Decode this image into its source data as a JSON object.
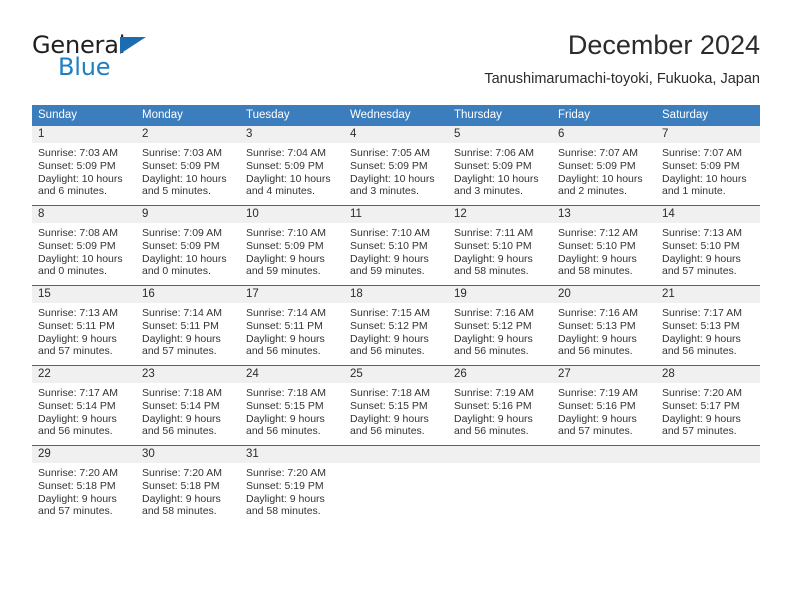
{
  "logo": {
    "line1": "General",
    "line2": "Blue",
    "triangle_color": "#1b6cb0",
    "blue_color": "#1e7fc4"
  },
  "header": {
    "title": "December 2024",
    "subtitle": "Tanushimarumachi-toyoki, Fukuoka, Japan"
  },
  "theme": {
    "header_blue": "#3B7DBD",
    "rule_blue": "#2E6DA4",
    "day_band": "#F0F0F0"
  },
  "weekdays": [
    "Sunday",
    "Monday",
    "Tuesday",
    "Wednesday",
    "Thursday",
    "Friday",
    "Saturday"
  ],
  "weeks": [
    [
      {
        "day": "1",
        "sunrise": "Sunrise: 7:03 AM",
        "sunset": "Sunset: 5:09 PM",
        "daylight_line1": "Daylight: 10 hours",
        "daylight_line2": "and 6 minutes."
      },
      {
        "day": "2",
        "sunrise": "Sunrise: 7:03 AM",
        "sunset": "Sunset: 5:09 PM",
        "daylight_line1": "Daylight: 10 hours",
        "daylight_line2": "and 5 minutes."
      },
      {
        "day": "3",
        "sunrise": "Sunrise: 7:04 AM",
        "sunset": "Sunset: 5:09 PM",
        "daylight_line1": "Daylight: 10 hours",
        "daylight_line2": "and 4 minutes."
      },
      {
        "day": "4",
        "sunrise": "Sunrise: 7:05 AM",
        "sunset": "Sunset: 5:09 PM",
        "daylight_line1": "Daylight: 10 hours",
        "daylight_line2": "and 3 minutes."
      },
      {
        "day": "5",
        "sunrise": "Sunrise: 7:06 AM",
        "sunset": "Sunset: 5:09 PM",
        "daylight_line1": "Daylight: 10 hours",
        "daylight_line2": "and 3 minutes."
      },
      {
        "day": "6",
        "sunrise": "Sunrise: 7:07 AM",
        "sunset": "Sunset: 5:09 PM",
        "daylight_line1": "Daylight: 10 hours",
        "daylight_line2": "and 2 minutes."
      },
      {
        "day": "7",
        "sunrise": "Sunrise: 7:07 AM",
        "sunset": "Sunset: 5:09 PM",
        "daylight_line1": "Daylight: 10 hours",
        "daylight_line2": "and 1 minute."
      }
    ],
    [
      {
        "day": "8",
        "sunrise": "Sunrise: 7:08 AM",
        "sunset": "Sunset: 5:09 PM",
        "daylight_line1": "Daylight: 10 hours",
        "daylight_line2": "and 0 minutes."
      },
      {
        "day": "9",
        "sunrise": "Sunrise: 7:09 AM",
        "sunset": "Sunset: 5:09 PM",
        "daylight_line1": "Daylight: 10 hours",
        "daylight_line2": "and 0 minutes."
      },
      {
        "day": "10",
        "sunrise": "Sunrise: 7:10 AM",
        "sunset": "Sunset: 5:09 PM",
        "daylight_line1": "Daylight: 9 hours",
        "daylight_line2": "and 59 minutes."
      },
      {
        "day": "11",
        "sunrise": "Sunrise: 7:10 AM",
        "sunset": "Sunset: 5:10 PM",
        "daylight_line1": "Daylight: 9 hours",
        "daylight_line2": "and 59 minutes."
      },
      {
        "day": "12",
        "sunrise": "Sunrise: 7:11 AM",
        "sunset": "Sunset: 5:10 PM",
        "daylight_line1": "Daylight: 9 hours",
        "daylight_line2": "and 58 minutes."
      },
      {
        "day": "13",
        "sunrise": "Sunrise: 7:12 AM",
        "sunset": "Sunset: 5:10 PM",
        "daylight_line1": "Daylight: 9 hours",
        "daylight_line2": "and 58 minutes."
      },
      {
        "day": "14",
        "sunrise": "Sunrise: 7:13 AM",
        "sunset": "Sunset: 5:10 PM",
        "daylight_line1": "Daylight: 9 hours",
        "daylight_line2": "and 57 minutes."
      }
    ],
    [
      {
        "day": "15",
        "sunrise": "Sunrise: 7:13 AM",
        "sunset": "Sunset: 5:11 PM",
        "daylight_line1": "Daylight: 9 hours",
        "daylight_line2": "and 57 minutes."
      },
      {
        "day": "16",
        "sunrise": "Sunrise: 7:14 AM",
        "sunset": "Sunset: 5:11 PM",
        "daylight_line1": "Daylight: 9 hours",
        "daylight_line2": "and 57 minutes."
      },
      {
        "day": "17",
        "sunrise": "Sunrise: 7:14 AM",
        "sunset": "Sunset: 5:11 PM",
        "daylight_line1": "Daylight: 9 hours",
        "daylight_line2": "and 56 minutes."
      },
      {
        "day": "18",
        "sunrise": "Sunrise: 7:15 AM",
        "sunset": "Sunset: 5:12 PM",
        "daylight_line1": "Daylight: 9 hours",
        "daylight_line2": "and 56 minutes."
      },
      {
        "day": "19",
        "sunrise": "Sunrise: 7:16 AM",
        "sunset": "Sunset: 5:12 PM",
        "daylight_line1": "Daylight: 9 hours",
        "daylight_line2": "and 56 minutes."
      },
      {
        "day": "20",
        "sunrise": "Sunrise: 7:16 AM",
        "sunset": "Sunset: 5:13 PM",
        "daylight_line1": "Daylight: 9 hours",
        "daylight_line2": "and 56 minutes."
      },
      {
        "day": "21",
        "sunrise": "Sunrise: 7:17 AM",
        "sunset": "Sunset: 5:13 PM",
        "daylight_line1": "Daylight: 9 hours",
        "daylight_line2": "and 56 minutes."
      }
    ],
    [
      {
        "day": "22",
        "sunrise": "Sunrise: 7:17 AM",
        "sunset": "Sunset: 5:14 PM",
        "daylight_line1": "Daylight: 9 hours",
        "daylight_line2": "and 56 minutes."
      },
      {
        "day": "23",
        "sunrise": "Sunrise: 7:18 AM",
        "sunset": "Sunset: 5:14 PM",
        "daylight_line1": "Daylight: 9 hours",
        "daylight_line2": "and 56 minutes."
      },
      {
        "day": "24",
        "sunrise": "Sunrise: 7:18 AM",
        "sunset": "Sunset: 5:15 PM",
        "daylight_line1": "Daylight: 9 hours",
        "daylight_line2": "and 56 minutes."
      },
      {
        "day": "25",
        "sunrise": "Sunrise: 7:18 AM",
        "sunset": "Sunset: 5:15 PM",
        "daylight_line1": "Daylight: 9 hours",
        "daylight_line2": "and 56 minutes."
      },
      {
        "day": "26",
        "sunrise": "Sunrise: 7:19 AM",
        "sunset": "Sunset: 5:16 PM",
        "daylight_line1": "Daylight: 9 hours",
        "daylight_line2": "and 56 minutes."
      },
      {
        "day": "27",
        "sunrise": "Sunrise: 7:19 AM",
        "sunset": "Sunset: 5:16 PM",
        "daylight_line1": "Daylight: 9 hours",
        "daylight_line2": "and 57 minutes."
      },
      {
        "day": "28",
        "sunrise": "Sunrise: 7:20 AM",
        "sunset": "Sunset: 5:17 PM",
        "daylight_line1": "Daylight: 9 hours",
        "daylight_line2": "and 57 minutes."
      }
    ],
    [
      {
        "day": "29",
        "sunrise": "Sunrise: 7:20 AM",
        "sunset": "Sunset: 5:18 PM",
        "daylight_line1": "Daylight: 9 hours",
        "daylight_line2": "and 57 minutes."
      },
      {
        "day": "30",
        "sunrise": "Sunrise: 7:20 AM",
        "sunset": "Sunset: 5:18 PM",
        "daylight_line1": "Daylight: 9 hours",
        "daylight_line2": "and 58 minutes."
      },
      {
        "day": "31",
        "sunrise": "Sunrise: 7:20 AM",
        "sunset": "Sunset: 5:19 PM",
        "daylight_line1": "Daylight: 9 hours",
        "daylight_line2": "and 58 minutes."
      },
      {
        "day": "",
        "sunrise": "",
        "sunset": "",
        "daylight_line1": "",
        "daylight_line2": ""
      },
      {
        "day": "",
        "sunrise": "",
        "sunset": "",
        "daylight_line1": "",
        "daylight_line2": ""
      },
      {
        "day": "",
        "sunrise": "",
        "sunset": "",
        "daylight_line1": "",
        "daylight_line2": ""
      },
      {
        "day": "",
        "sunrise": "",
        "sunset": "",
        "daylight_line1": "",
        "daylight_line2": ""
      }
    ]
  ]
}
